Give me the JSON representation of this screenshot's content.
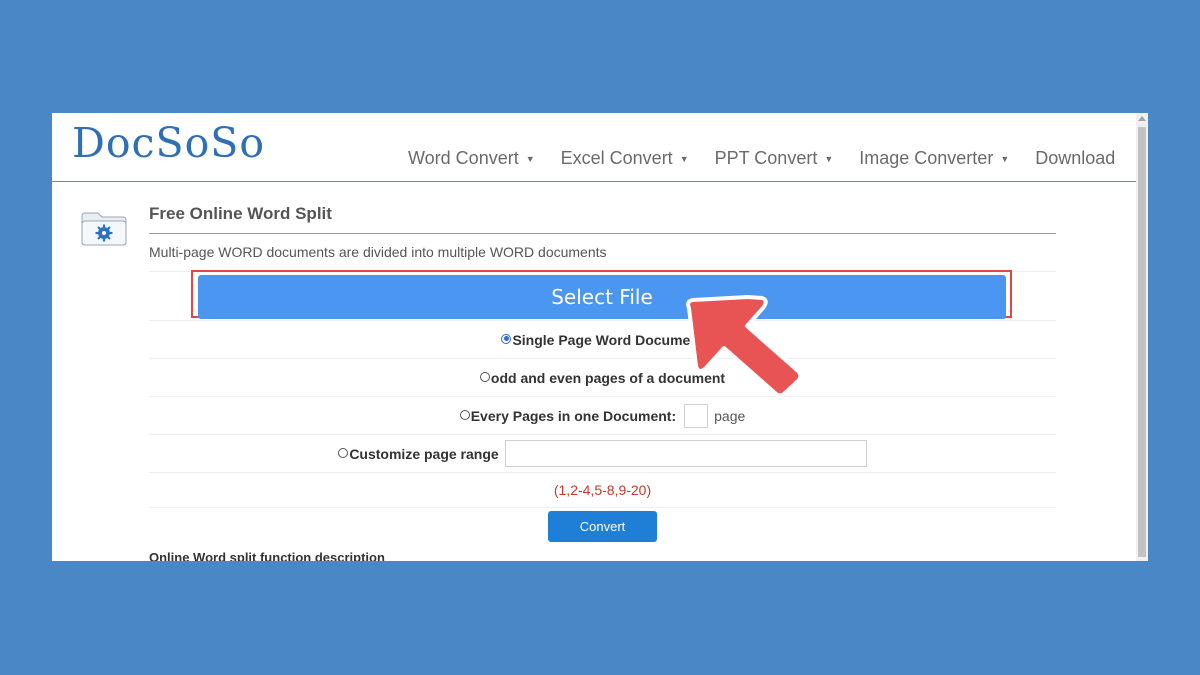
{
  "logo": {
    "text": "DocSoSo"
  },
  "nav": {
    "items": [
      {
        "label": "Word Convert",
        "has_dropdown": true
      },
      {
        "label": "Excel Convert",
        "has_dropdown": true
      },
      {
        "label": "PPT Convert",
        "has_dropdown": true
      },
      {
        "label": "Image Converter",
        "has_dropdown": true
      },
      {
        "label": "Download",
        "has_dropdown": false
      }
    ],
    "caret": "▼"
  },
  "main": {
    "icon": "folder-gear-icon",
    "title": "Free Online Word Split",
    "description": "Multi-page WORD documents are divided into multiple WORD documents",
    "select_file_label": "Select File",
    "options": {
      "single_page": {
        "label": "Single Page Word Document",
        "checked": true
      },
      "odd_even": {
        "label": "odd and even pages of a document",
        "checked": false
      },
      "every_pages": {
        "label": "Every Pages in one Document:",
        "unit": "page",
        "value": "",
        "checked": false
      },
      "custom_range": {
        "label": "Customize page range",
        "value": "",
        "checked": false
      }
    },
    "range_hint": "(1,2-4,5-8,9-20)",
    "convert_label": "Convert",
    "function_description": "Online Word split function description"
  },
  "colors": {
    "background": "#4a87c6",
    "select_button": "#4b96f0",
    "convert_button": "#1f7fd6",
    "highlight_border": "#e04848",
    "arrow": "#e85353",
    "hint_text": "#c43a2a"
  }
}
